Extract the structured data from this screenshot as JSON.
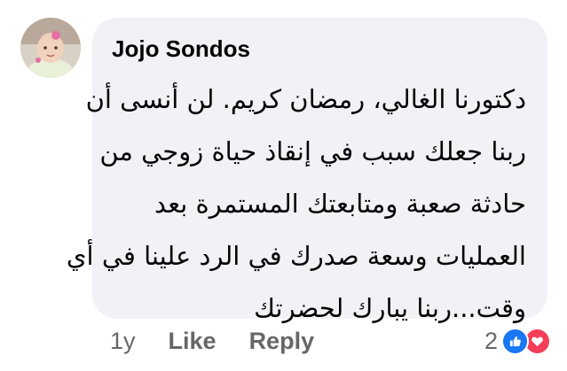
{
  "comment": {
    "author": "Jojo Sondos",
    "lines": [
      "دكتورنا الغالي، رمضان كريم. لن أنسى أن",
      "ربنا جعلك سبب في إنقاذ حياة زوجي من",
      "حادثة صعبة ومتابعتك المستمرة بعد",
      "العمليات وسعة صدرك في الرد علينا في أي",
      "وقت...ربنا يبارك لحضرتك"
    ]
  },
  "actions": {
    "time": "1y",
    "like_label": "Like",
    "reply_label": "Reply"
  },
  "reactions": {
    "count": "2",
    "icons": [
      "like-icon",
      "love-icon"
    ],
    "colors": {
      "like": "#1877f2",
      "love": "#f33e58"
    }
  },
  "theme": {
    "bubble": "#f0f2f5",
    "text": "#050505",
    "muted": "#65676b"
  }
}
